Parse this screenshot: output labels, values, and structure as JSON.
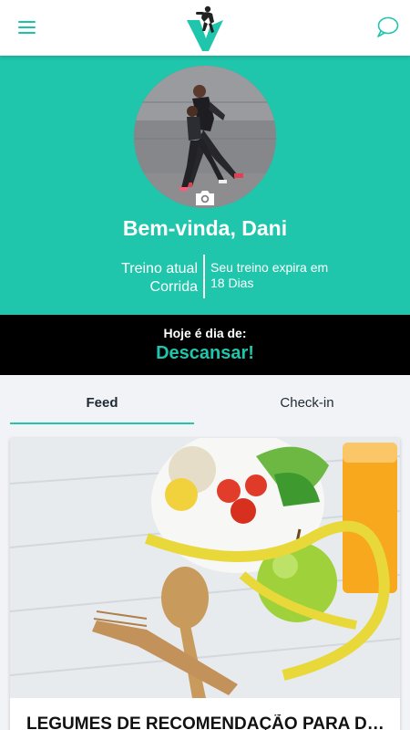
{
  "header": {
    "menu_icon": "hamburger-menu-icon",
    "logo_icon": "v-fitness-logo",
    "chat_icon": "chat-bubble-icon",
    "accent_color": "#1fc6ab"
  },
  "profile": {
    "photo_icon": "runners-photo",
    "camera_icon": "camera-icon",
    "welcome": "Bem-vinda, Dani",
    "current_training_label": "Treino atual",
    "current_training_value": "Corrida",
    "expires_label": "Seu treino expira em",
    "expires_value": "18 Dias"
  },
  "today": {
    "label": "Hoje é dia de:",
    "value": "Descansar!"
  },
  "tabs": [
    {
      "label": "Feed",
      "active": true
    },
    {
      "label": "Check-in",
      "active": false
    }
  ],
  "feed": {
    "cards": [
      {
        "image_icon": "vegetables-salad-measuring-tape-photo",
        "title": "LEGUMES DE RECOMENDAÇÃO PARA DIETA"
      }
    ]
  }
}
